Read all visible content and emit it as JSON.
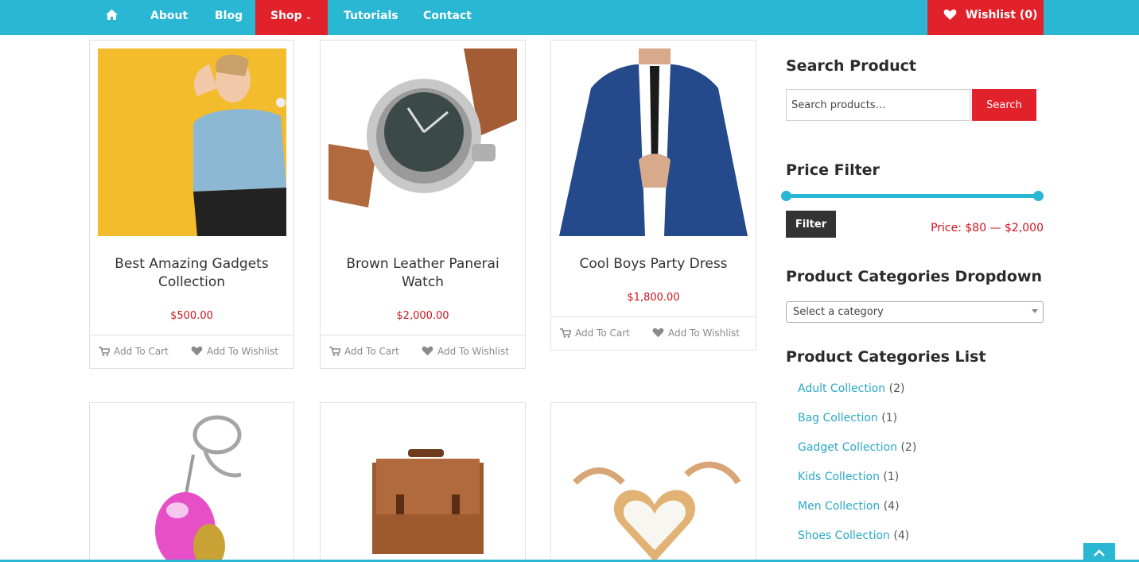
{
  "nav": {
    "items": [
      {
        "label": "About"
      },
      {
        "label": "Blog"
      },
      {
        "label": "Shop"
      },
      {
        "label": "Tutorials"
      },
      {
        "label": "Contact"
      }
    ],
    "home_icon": "home-icon",
    "shop_caret_icon": "chevron-down-icon",
    "wishlist": {
      "label": "Wishlist",
      "count": "(0)",
      "icon": "heart-icon"
    }
  },
  "colors": {
    "primary": "#29b7d4",
    "accent": "#e2222b",
    "price": "#d0131d",
    "dark": "#333333"
  },
  "products": [
    {
      "title_line1": "Best Amazing Gadgets",
      "title_line2": "Collection",
      "price": "$500.00",
      "add_to_cart": "Add To Cart",
      "add_to_wishlist": "Add To Wishlist"
    },
    {
      "title_line1": "Brown Leather Panerai",
      "title_line2": "Watch",
      "price": "$2,000.00",
      "add_to_cart": "Add To Cart",
      "add_to_wishlist": "Add To Wishlist"
    },
    {
      "title_line1": "Cool Boys Party Dress",
      "title_line2": "",
      "price": "$1,800.00",
      "add_to_cart": "Add To Cart",
      "add_to_wishlist": "Add To Wishlist"
    }
  ],
  "sidebar": {
    "search": {
      "title": "Search Product",
      "placeholder": "Search products…",
      "button": "Search"
    },
    "price_filter": {
      "title": "Price Filter",
      "button": "Filter",
      "range": "Price: $80 — $2,000"
    },
    "categories_dropdown": {
      "title": "Product Categories Dropdown",
      "selected": "Select a category"
    },
    "categories_list": {
      "title": "Product Categories List",
      "items": [
        {
          "name": "Adult Collection",
          "count": "(2)"
        },
        {
          "name": "Bag Collection",
          "count": "(1)"
        },
        {
          "name": "Gadget Collection",
          "count": "(2)"
        },
        {
          "name": "Kids Collection",
          "count": "(1)"
        },
        {
          "name": "Men Collection",
          "count": "(4)"
        },
        {
          "name": "Shoes Collection",
          "count": "(4)"
        }
      ]
    }
  }
}
